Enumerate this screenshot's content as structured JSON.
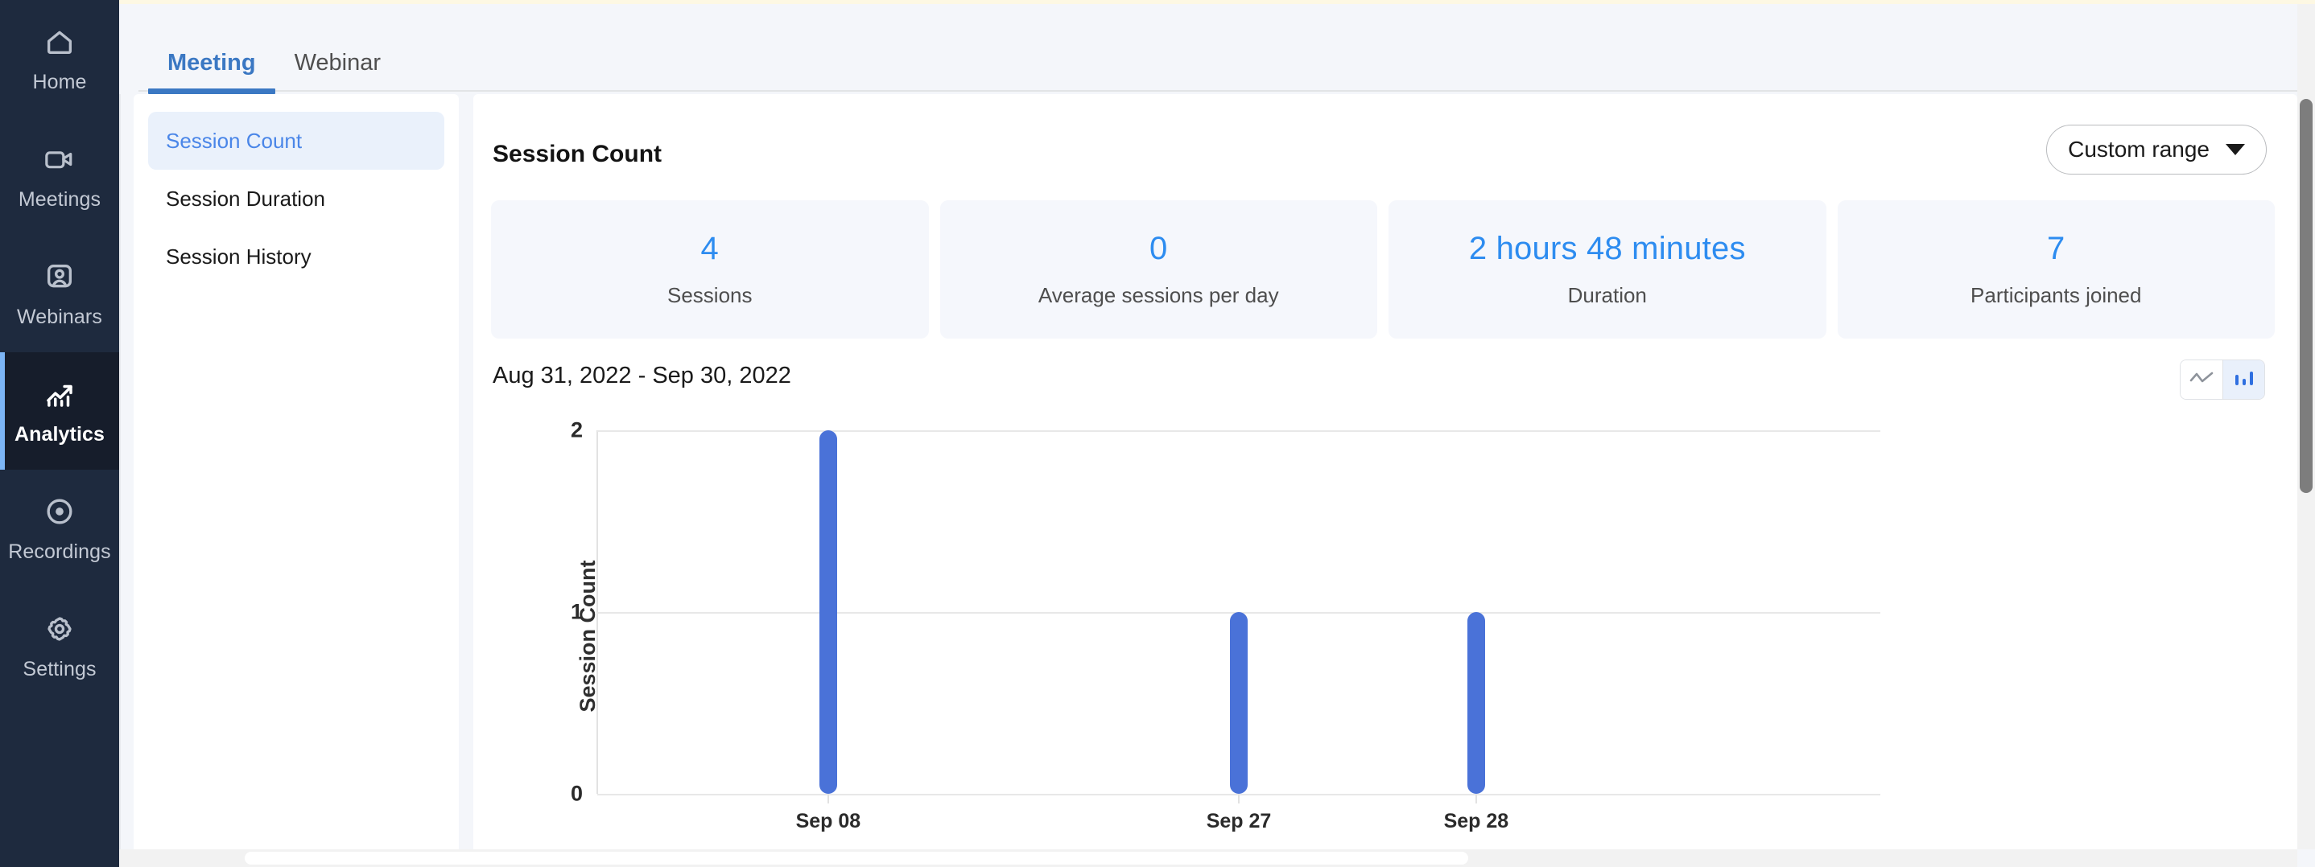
{
  "theme": {
    "rail_bg": "#1e2a3e",
    "rail_active_bg": "#161d2b",
    "accent_blue": "#3b78c3",
    "link_blue": "#4a86e8",
    "value_blue": "#2d8cf0",
    "bar_blue": "#4a72d8",
    "page_bg": "#f4f6fa",
    "card_bg": "#f5f7fc"
  },
  "rail": {
    "items": [
      {
        "label": "Home",
        "icon": "home-icon",
        "active": false
      },
      {
        "label": "Meetings",
        "icon": "video-camera-icon",
        "active": false
      },
      {
        "label": "Webinars",
        "icon": "person-screen-icon",
        "active": false
      },
      {
        "label": "Analytics",
        "icon": "analytics-chart-icon",
        "active": true
      },
      {
        "label": "Recordings",
        "icon": "record-circle-icon",
        "active": false
      },
      {
        "label": "Settings",
        "icon": "gear-icon",
        "active": false
      }
    ]
  },
  "header": {
    "tabs": [
      {
        "label": "Meeting",
        "active": true
      },
      {
        "label": "Webinar",
        "active": false
      }
    ]
  },
  "subnav": {
    "items": [
      {
        "label": "Session Count",
        "active": true
      },
      {
        "label": "Session Duration",
        "active": false
      },
      {
        "label": "Session History",
        "active": false
      }
    ]
  },
  "main": {
    "title": "Session Count",
    "range_button": {
      "label": "Custom range",
      "icon": "chevron-down-icon"
    },
    "cards": [
      {
        "value": "4",
        "label": "Sessions"
      },
      {
        "value": "0",
        "label": "Average sessions per day"
      },
      {
        "value": "2 hours 48 minutes",
        "label": "Duration"
      },
      {
        "value": "7",
        "label": "Participants joined"
      }
    ],
    "chart_range_label": "Aug 31, 2022 - Sep 30, 2022",
    "chart_toggle": [
      {
        "icon": "line-chart-icon",
        "active": false
      },
      {
        "icon": "bar-chart-icon",
        "active": true
      }
    ]
  },
  "chart_data": {
    "type": "bar",
    "title": "Session Count",
    "subtitle": "Aug 31, 2022 - Sep 30, 2022",
    "xlabel": "",
    "ylabel": "Session Count",
    "categories": [
      "Sep 08",
      "Sep 27",
      "Sep 28"
    ],
    "values": [
      2,
      1,
      1
    ],
    "yticks": [
      0,
      1,
      2
    ],
    "ylim": [
      0,
      2
    ],
    "grid": true,
    "legend": "none",
    "series": [
      {
        "name": "Session Count",
        "values": [
          2,
          1,
          1
        ],
        "color": "#4a72d8"
      }
    ]
  }
}
